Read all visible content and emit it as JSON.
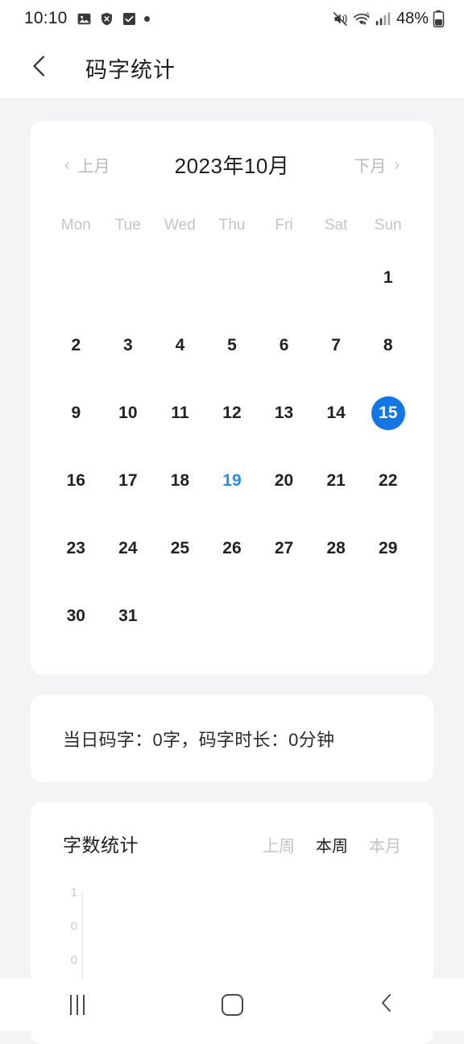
{
  "status_bar": {
    "time": "10:10",
    "left_icons": [
      "image-icon",
      "shield-x-icon",
      "checkbox-checked-icon",
      "dot-icon"
    ],
    "right_icons": [
      "mute-vibrate-icon",
      "wifi-6-icon",
      "cellular-signal-icon",
      "battery-icon"
    ],
    "battery_percent": "48%"
  },
  "header": {
    "back_icon": "back-chevron-icon",
    "title": "码字统计"
  },
  "calendar": {
    "prev_label": "上月",
    "next_label": "下月",
    "month_label": "2023年10月",
    "prev_chevron": "‹",
    "next_chevron": "›",
    "weekdays": [
      "Mon",
      "Tue",
      "Wed",
      "Thu",
      "Fri",
      "Sat",
      "Sun"
    ],
    "weeks": [
      [
        {
          "day": "",
          "state": "empty"
        },
        {
          "day": "",
          "state": "empty"
        },
        {
          "day": "",
          "state": "empty"
        },
        {
          "day": "",
          "state": "empty"
        },
        {
          "day": "",
          "state": "empty"
        },
        {
          "day": "",
          "state": "empty"
        },
        {
          "day": "1",
          "state": "normal"
        }
      ],
      [
        {
          "day": "2",
          "state": "normal"
        },
        {
          "day": "3",
          "state": "normal"
        },
        {
          "day": "4",
          "state": "normal"
        },
        {
          "day": "5",
          "state": "normal"
        },
        {
          "day": "6",
          "state": "normal"
        },
        {
          "day": "7",
          "state": "normal"
        },
        {
          "day": "8",
          "state": "normal"
        }
      ],
      [
        {
          "day": "9",
          "state": "normal"
        },
        {
          "day": "10",
          "state": "normal"
        },
        {
          "day": "11",
          "state": "normal"
        },
        {
          "day": "12",
          "state": "normal"
        },
        {
          "day": "13",
          "state": "normal"
        },
        {
          "day": "14",
          "state": "normal"
        },
        {
          "day": "15",
          "state": "selected"
        }
      ],
      [
        {
          "day": "16",
          "state": "normal"
        },
        {
          "day": "17",
          "state": "normal"
        },
        {
          "day": "18",
          "state": "normal"
        },
        {
          "day": "19",
          "state": "today"
        },
        {
          "day": "20",
          "state": "normal"
        },
        {
          "day": "21",
          "state": "normal"
        },
        {
          "day": "22",
          "state": "normal"
        }
      ],
      [
        {
          "day": "23",
          "state": "normal"
        },
        {
          "day": "24",
          "state": "normal"
        },
        {
          "day": "25",
          "state": "normal"
        },
        {
          "day": "26",
          "state": "normal"
        },
        {
          "day": "27",
          "state": "normal"
        },
        {
          "day": "28",
          "state": "normal"
        },
        {
          "day": "29",
          "state": "normal"
        }
      ],
      [
        {
          "day": "30",
          "state": "normal"
        },
        {
          "day": "31",
          "state": "normal"
        },
        {
          "day": "",
          "state": "empty"
        },
        {
          "day": "",
          "state": "empty"
        },
        {
          "day": "",
          "state": "empty"
        },
        {
          "day": "",
          "state": "empty"
        },
        {
          "day": "",
          "state": "empty"
        }
      ]
    ],
    "selected_day": "15",
    "today": "19",
    "selected_color": "#1476e2",
    "today_color": "#2b8cf0"
  },
  "summary": {
    "text": "当日码字：0字，码字时长：0分钟"
  },
  "chart_card": {
    "title": "字数统计",
    "tabs": [
      {
        "label": "上周",
        "active": false
      },
      {
        "label": "本周",
        "active": true
      },
      {
        "label": "本月",
        "active": false
      }
    ]
  },
  "chart_data": {
    "type": "bar",
    "title": "字数统计",
    "categories": [],
    "values": [],
    "series": [
      {
        "name": "本周",
        "values": []
      }
    ],
    "ytick_labels": [
      "1",
      "0",
      "0"
    ],
    "ylim": [
      0,
      1
    ],
    "xlabel": "",
    "ylabel": "",
    "grid": false,
    "legend": "none",
    "note": "chart area is clipped by the bottom of the viewport; only the y-axis and its tick labels 1 / 0 / 0 are visible, no bars rendered"
  },
  "nav_bar": {
    "buttons": [
      {
        "name": "recents-button",
        "icon": "recents-icon"
      },
      {
        "name": "home-button",
        "icon": "home-icon"
      },
      {
        "name": "back-button",
        "icon": "back-chevron-icon"
      }
    ]
  }
}
